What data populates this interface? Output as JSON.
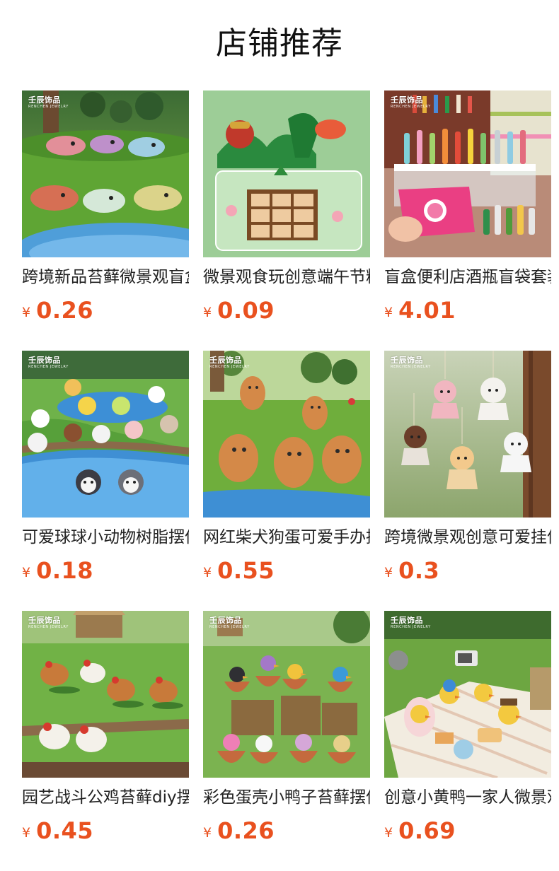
{
  "page": {
    "title": "店铺推荐",
    "brand_text": "壬辰饰品",
    "brand_sub": "RENCHEN JEWELRY",
    "currency_symbol": "¥",
    "price_color": "#e9511f"
  },
  "products": [
    {
      "name": "跨境新品苔藓微景观盲盒",
      "price": "0.26",
      "image": "glitter-dragons-on-moss"
    },
    {
      "name": "微景观食玩创意端午节粽子",
      "price": "0.09",
      "image": "dragon-boat-and-zongzi-tray"
    },
    {
      "name": "盲盒便利店酒瓶盲袋套装",
      "price": "4.01",
      "image": "convenience-store-bottles-and-mystery-bag"
    },
    {
      "name": "可爱球球小动物树脂摆件",
      "price": "0.18",
      "image": "round-animal-heads-by-pond"
    },
    {
      "name": "网红柴犬狗蛋可爱手办摆件",
      "price": "0.55",
      "image": "orange-shiba-figurines-on-grass"
    },
    {
      "name": "跨境微景观创意可爱挂件",
      "price": "0.3",
      "image": "hanging-animal-dolls"
    },
    {
      "name": "园艺战斗公鸡苔藓diy摆件",
      "price": "0.45",
      "image": "roosters-and-hens-on-grass"
    },
    {
      "name": "彩色蛋壳小鸭子苔藓摆件",
      "price": "0.26",
      "image": "colorful-ducklings-in-eggshells"
    },
    {
      "name": "创意小黄鸭一家人微景观",
      "price": "0.69",
      "image": "duck-family-picnic"
    }
  ]
}
